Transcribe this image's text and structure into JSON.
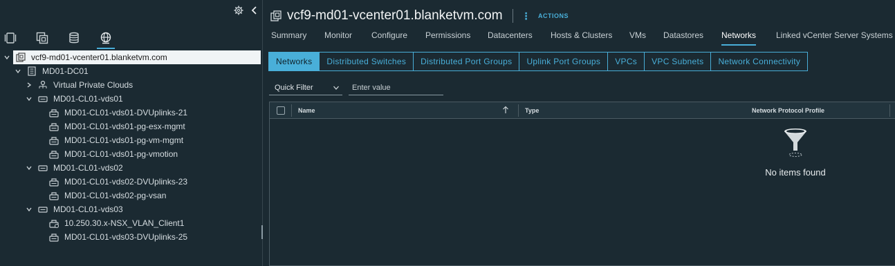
{
  "left": {
    "tree": [
      {
        "label": "vcf9-md01-vcenter01.blanketvm.com",
        "icon": "vcenter-icon",
        "selected": true
      },
      {
        "label": "MD01-DC01",
        "icon": "datacenter-icon"
      },
      {
        "label": "Virtual Private Clouds",
        "icon": "vpc-icon"
      },
      {
        "label": "MD01-CL01-vds01",
        "icon": "distributed-switch-icon"
      },
      {
        "label": "MD01-CL01-vds01-DVUplinks-21",
        "icon": "portgroup-icon"
      },
      {
        "label": "MD01-CL01-vds01-pg-esx-mgmt",
        "icon": "portgroup-icon"
      },
      {
        "label": "MD01-CL01-vds01-pg-vm-mgmt",
        "icon": "portgroup-icon"
      },
      {
        "label": "MD01-CL01-vds01-pg-vmotion",
        "icon": "portgroup-icon"
      },
      {
        "label": "MD01-CL01-vds02",
        "icon": "distributed-switch-icon"
      },
      {
        "label": "MD01-CL01-vds02-DVUplinks-23",
        "icon": "portgroup-icon"
      },
      {
        "label": "MD01-CL01-vds02-pg-vsan",
        "icon": "portgroup-icon"
      },
      {
        "label": "MD01-CL01-vds03",
        "icon": "distributed-switch-icon"
      },
      {
        "label": "10.250.30.x-NSX_VLAN_Client1",
        "icon": "nsx-portgroup-icon"
      },
      {
        "label": "MD01-CL01-vds03-DVUplinks-25",
        "icon": "portgroup-icon"
      }
    ]
  },
  "header": {
    "title": "vcf9-md01-vcenter01.blanketvm.com",
    "actions_label": "ACTIONS"
  },
  "tabs": [
    "Summary",
    "Monitor",
    "Configure",
    "Permissions",
    "Datacenters",
    "Hosts & Clusters",
    "VMs",
    "Datastores",
    "Networks",
    "Linked vCenter Server Systems"
  ],
  "active_tab": "Networks",
  "subtabs": [
    "Networks",
    "Distributed Switches",
    "Distributed Port Groups",
    "Uplink Port Groups",
    "VPCs",
    "VPC Subnets",
    "Network Connectivity"
  ],
  "active_subtab": "Networks",
  "filter": {
    "quick_filter_label": "Quick Filter",
    "value_placeholder": "Enter value"
  },
  "grid": {
    "columns": [
      "Name",
      "Type",
      "Network Protocol Profile"
    ],
    "empty_text": "No items found"
  },
  "colors": {
    "accent": "#49afd9",
    "background": "#1b2a32"
  }
}
